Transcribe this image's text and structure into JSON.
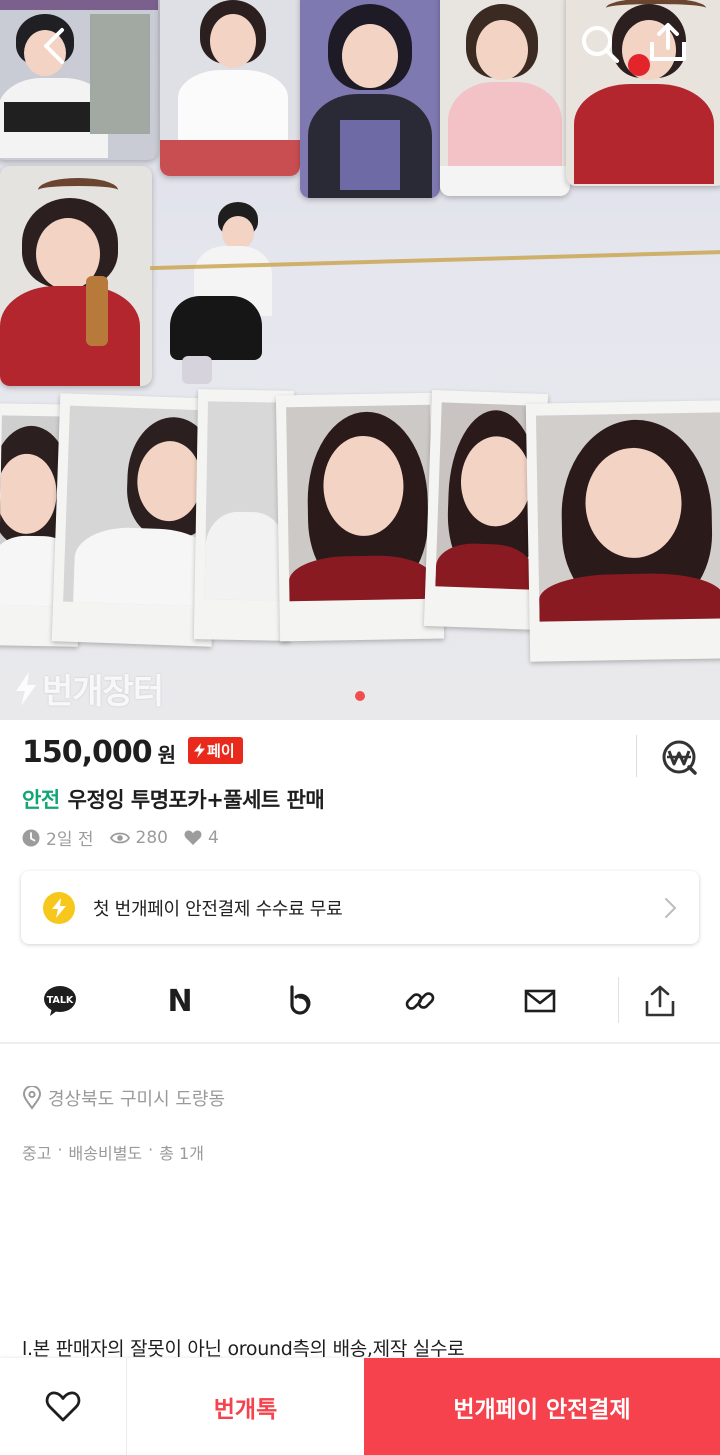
{
  "colors": {
    "accent_red": "#f5424d",
    "pay_badge": "#e8291c",
    "safe_green": "#12a772",
    "bolt_yellow": "#f8c71c",
    "gray_text": "#9c9c9c",
    "page_indicator": "#f04e4e"
  },
  "topbar": {
    "back_icon": "chevron-left-icon",
    "search_icon": "search-icon",
    "share_icon": "share-icon"
  },
  "hero": {
    "watermark": "번개장터",
    "image_count_dots": 1
  },
  "product": {
    "price": "150,000",
    "currency": "원",
    "pay_badge": "페이",
    "safe_label": "안전",
    "title": "우정잉 투명포카+풀세트 판매",
    "time_ago": "2일 전",
    "views": "280",
    "likes": "4"
  },
  "promo": {
    "text": "첫 번개페이 안전결제 수수료 무료"
  },
  "share": {
    "items": [
      "kakaotalk",
      "naver",
      "band",
      "link",
      "mail",
      "share"
    ],
    "talk_label": "TALK",
    "naver_label": "N"
  },
  "details": {
    "location": "경상북도 구미시 도량동",
    "condition": "중고",
    "shipping": "배송비별도",
    "quantity": "총 1개",
    "description_line": "l.본 판매자의 잘못이 아닌 oround측의 배송,제작 실수로"
  },
  "bottombar": {
    "chat_label": "번개톡",
    "pay_label": "번개페이 안전결제"
  }
}
